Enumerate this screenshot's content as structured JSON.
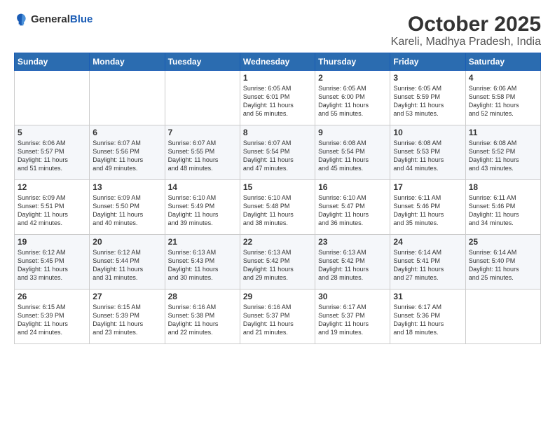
{
  "logo": {
    "general": "General",
    "blue": "Blue"
  },
  "header": {
    "month": "October 2025",
    "location": "Kareli, Madhya Pradesh, India"
  },
  "weekdays": [
    "Sunday",
    "Monday",
    "Tuesday",
    "Wednesday",
    "Thursday",
    "Friday",
    "Saturday"
  ],
  "weeks": [
    [
      {
        "day": "",
        "info": ""
      },
      {
        "day": "",
        "info": ""
      },
      {
        "day": "",
        "info": ""
      },
      {
        "day": "1",
        "info": "Sunrise: 6:05 AM\nSunset: 6:01 PM\nDaylight: 11 hours\nand 56 minutes."
      },
      {
        "day": "2",
        "info": "Sunrise: 6:05 AM\nSunset: 6:00 PM\nDaylight: 11 hours\nand 55 minutes."
      },
      {
        "day": "3",
        "info": "Sunrise: 6:05 AM\nSunset: 5:59 PM\nDaylight: 11 hours\nand 53 minutes."
      },
      {
        "day": "4",
        "info": "Sunrise: 6:06 AM\nSunset: 5:58 PM\nDaylight: 11 hours\nand 52 minutes."
      }
    ],
    [
      {
        "day": "5",
        "info": "Sunrise: 6:06 AM\nSunset: 5:57 PM\nDaylight: 11 hours\nand 51 minutes."
      },
      {
        "day": "6",
        "info": "Sunrise: 6:07 AM\nSunset: 5:56 PM\nDaylight: 11 hours\nand 49 minutes."
      },
      {
        "day": "7",
        "info": "Sunrise: 6:07 AM\nSunset: 5:55 PM\nDaylight: 11 hours\nand 48 minutes."
      },
      {
        "day": "8",
        "info": "Sunrise: 6:07 AM\nSunset: 5:54 PM\nDaylight: 11 hours\nand 47 minutes."
      },
      {
        "day": "9",
        "info": "Sunrise: 6:08 AM\nSunset: 5:54 PM\nDaylight: 11 hours\nand 45 minutes."
      },
      {
        "day": "10",
        "info": "Sunrise: 6:08 AM\nSunset: 5:53 PM\nDaylight: 11 hours\nand 44 minutes."
      },
      {
        "day": "11",
        "info": "Sunrise: 6:08 AM\nSunset: 5:52 PM\nDaylight: 11 hours\nand 43 minutes."
      }
    ],
    [
      {
        "day": "12",
        "info": "Sunrise: 6:09 AM\nSunset: 5:51 PM\nDaylight: 11 hours\nand 42 minutes."
      },
      {
        "day": "13",
        "info": "Sunrise: 6:09 AM\nSunset: 5:50 PM\nDaylight: 11 hours\nand 40 minutes."
      },
      {
        "day": "14",
        "info": "Sunrise: 6:10 AM\nSunset: 5:49 PM\nDaylight: 11 hours\nand 39 minutes."
      },
      {
        "day": "15",
        "info": "Sunrise: 6:10 AM\nSunset: 5:48 PM\nDaylight: 11 hours\nand 38 minutes."
      },
      {
        "day": "16",
        "info": "Sunrise: 6:10 AM\nSunset: 5:47 PM\nDaylight: 11 hours\nand 36 minutes."
      },
      {
        "day": "17",
        "info": "Sunrise: 6:11 AM\nSunset: 5:46 PM\nDaylight: 11 hours\nand 35 minutes."
      },
      {
        "day": "18",
        "info": "Sunrise: 6:11 AM\nSunset: 5:46 PM\nDaylight: 11 hours\nand 34 minutes."
      }
    ],
    [
      {
        "day": "19",
        "info": "Sunrise: 6:12 AM\nSunset: 5:45 PM\nDaylight: 11 hours\nand 33 minutes."
      },
      {
        "day": "20",
        "info": "Sunrise: 6:12 AM\nSunset: 5:44 PM\nDaylight: 11 hours\nand 31 minutes."
      },
      {
        "day": "21",
        "info": "Sunrise: 6:13 AM\nSunset: 5:43 PM\nDaylight: 11 hours\nand 30 minutes."
      },
      {
        "day": "22",
        "info": "Sunrise: 6:13 AM\nSunset: 5:42 PM\nDaylight: 11 hours\nand 29 minutes."
      },
      {
        "day": "23",
        "info": "Sunrise: 6:13 AM\nSunset: 5:42 PM\nDaylight: 11 hours\nand 28 minutes."
      },
      {
        "day": "24",
        "info": "Sunrise: 6:14 AM\nSunset: 5:41 PM\nDaylight: 11 hours\nand 27 minutes."
      },
      {
        "day": "25",
        "info": "Sunrise: 6:14 AM\nSunset: 5:40 PM\nDaylight: 11 hours\nand 25 minutes."
      }
    ],
    [
      {
        "day": "26",
        "info": "Sunrise: 6:15 AM\nSunset: 5:39 PM\nDaylight: 11 hours\nand 24 minutes."
      },
      {
        "day": "27",
        "info": "Sunrise: 6:15 AM\nSunset: 5:39 PM\nDaylight: 11 hours\nand 23 minutes."
      },
      {
        "day": "28",
        "info": "Sunrise: 6:16 AM\nSunset: 5:38 PM\nDaylight: 11 hours\nand 22 minutes."
      },
      {
        "day": "29",
        "info": "Sunrise: 6:16 AM\nSunset: 5:37 PM\nDaylight: 11 hours\nand 21 minutes."
      },
      {
        "day": "30",
        "info": "Sunrise: 6:17 AM\nSunset: 5:37 PM\nDaylight: 11 hours\nand 19 minutes."
      },
      {
        "day": "31",
        "info": "Sunrise: 6:17 AM\nSunset: 5:36 PM\nDaylight: 11 hours\nand 18 minutes."
      },
      {
        "day": "",
        "info": ""
      }
    ]
  ]
}
